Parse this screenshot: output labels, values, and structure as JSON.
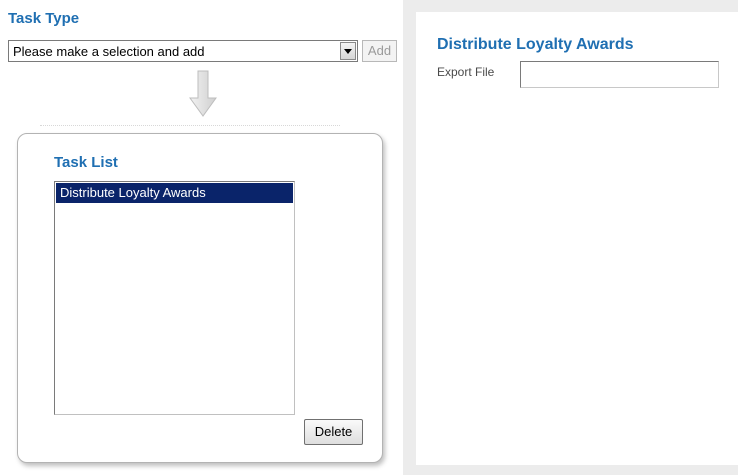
{
  "task_type": {
    "title": "Task Type",
    "select_value": "Please make a selection and add",
    "add_label": "Add"
  },
  "task_list": {
    "title": "Task List",
    "items": [
      {
        "label": "Distribute Loyalty Awards",
        "selected": true
      }
    ],
    "delete_label": "Delete"
  },
  "detail": {
    "title": "Distribute Loyalty Awards",
    "export_file_label": "Export File",
    "export_file_value": ""
  },
  "colors": {
    "heading_blue": "#1f6fb2",
    "selection_navy": "#0a246a"
  },
  "icons": {
    "flow_arrow": "down-arrow-icon"
  }
}
